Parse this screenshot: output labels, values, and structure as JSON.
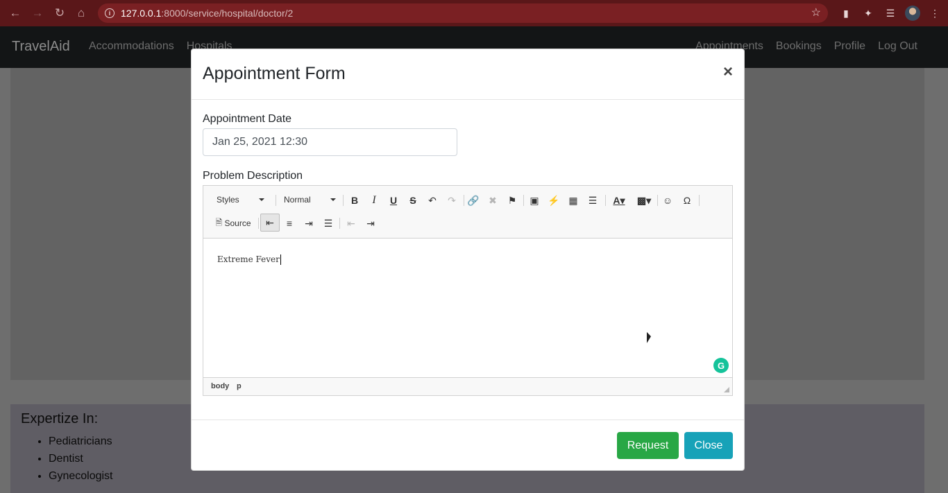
{
  "browser": {
    "url_host": "127.0.0.1",
    "url_path": ":8000/service/hospital/doctor/2"
  },
  "navbar": {
    "brand": "TravelAid",
    "left_links": [
      "Accommodations",
      "Hospitals"
    ],
    "right_links": [
      "Appointments",
      "Bookings",
      "Profile",
      "Log Out"
    ]
  },
  "background": {
    "expertize_title": "Expertize In:",
    "expertize_items": [
      "Pediatricians",
      "Dentist",
      "Gynecologist"
    ]
  },
  "modal": {
    "title": "Appointment Form",
    "close_symbol": "×",
    "date_label": "Appointment Date",
    "date_value": "Jan 25, 2021 12:30",
    "problem_label": "Problem Description",
    "editor": {
      "styles_combo": "Styles",
      "format_combo": "Normal",
      "source_label": "Source",
      "content": "Extreme Fever",
      "path_body": "body",
      "path_p": "p"
    },
    "request_button": "Request",
    "close_button": "Close"
  }
}
